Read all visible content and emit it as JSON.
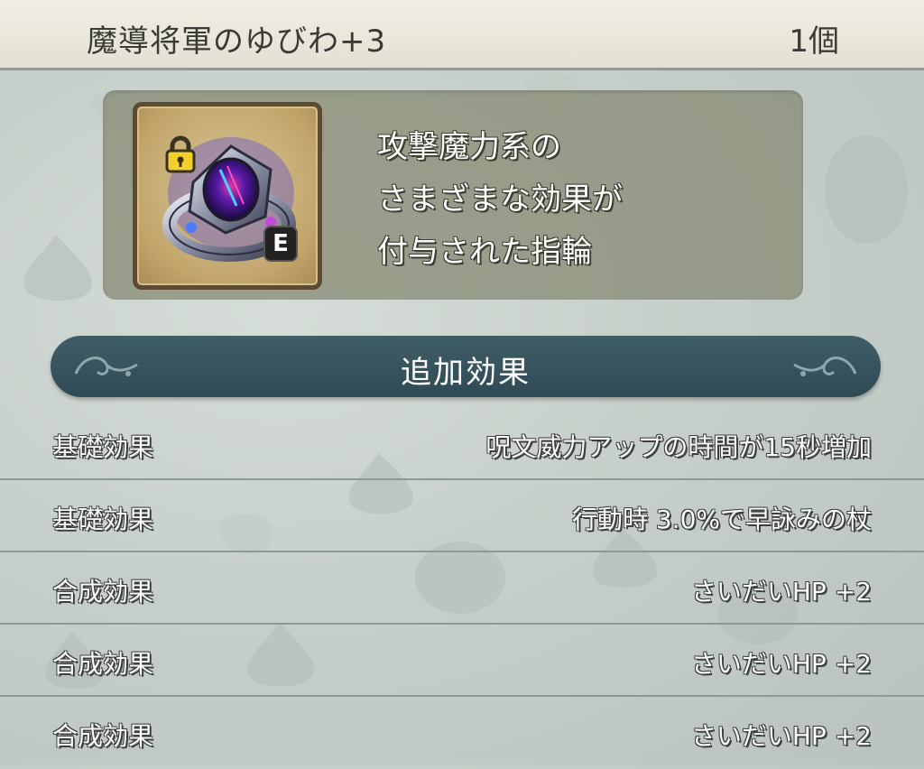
{
  "item": {
    "name": "魔導将軍のゆびわ+3",
    "count": "1個",
    "icon": "ring-icon",
    "lock_icon": "lock-icon",
    "equip_badge": "E",
    "description_lines": [
      "攻撃魔力系の",
      "さまざまな効果が",
      "付与された指輪"
    ]
  },
  "section": {
    "title": "追加効果"
  },
  "effects": [
    {
      "label": "基礎効果",
      "value": "呪文威力アップの時間が15秒増加"
    },
    {
      "label": "基礎効果",
      "value": "行動時 3.0%で早詠みの杖"
    },
    {
      "label": "合成効果",
      "value": "さいだいHP +2"
    },
    {
      "label": "合成効果",
      "value": "さいだいHP +2"
    },
    {
      "label": "合成効果",
      "value": "さいだいHP +2"
    }
  ],
  "colors": {
    "banner": "#2f4a54",
    "panel": "#84886f",
    "header": "#ece8dc"
  }
}
